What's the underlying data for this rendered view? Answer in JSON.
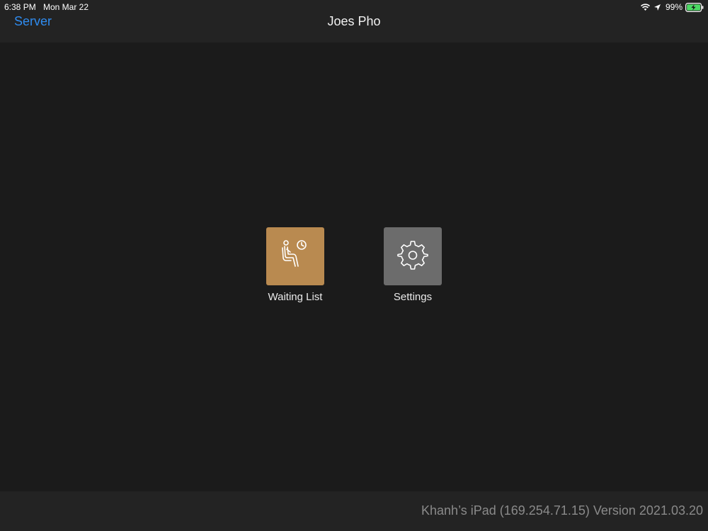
{
  "status_bar": {
    "time": "6:38 PM",
    "date": "Mon Mar 22",
    "battery_percent": "99%",
    "icons": [
      "wifi-icon",
      "location-arrow-icon",
      "battery-charging-icon"
    ]
  },
  "nav": {
    "back_label": "Server",
    "title": "Joes Pho"
  },
  "tiles": [
    {
      "label": "Waiting List",
      "icon": "waiting-person-clock-icon",
      "color": "#b98a50"
    },
    {
      "label": "Settings",
      "icon": "gear-icon",
      "color": "#6c6c6c"
    }
  ],
  "footer": {
    "device_info": "Khanh’s iPad (169.254.71.15) Version 2021.03.20"
  },
  "colors": {
    "accent": "#2f8cf0",
    "background": "#1b1b1b",
    "bar_background": "#232323",
    "battery": "#4cd964"
  }
}
